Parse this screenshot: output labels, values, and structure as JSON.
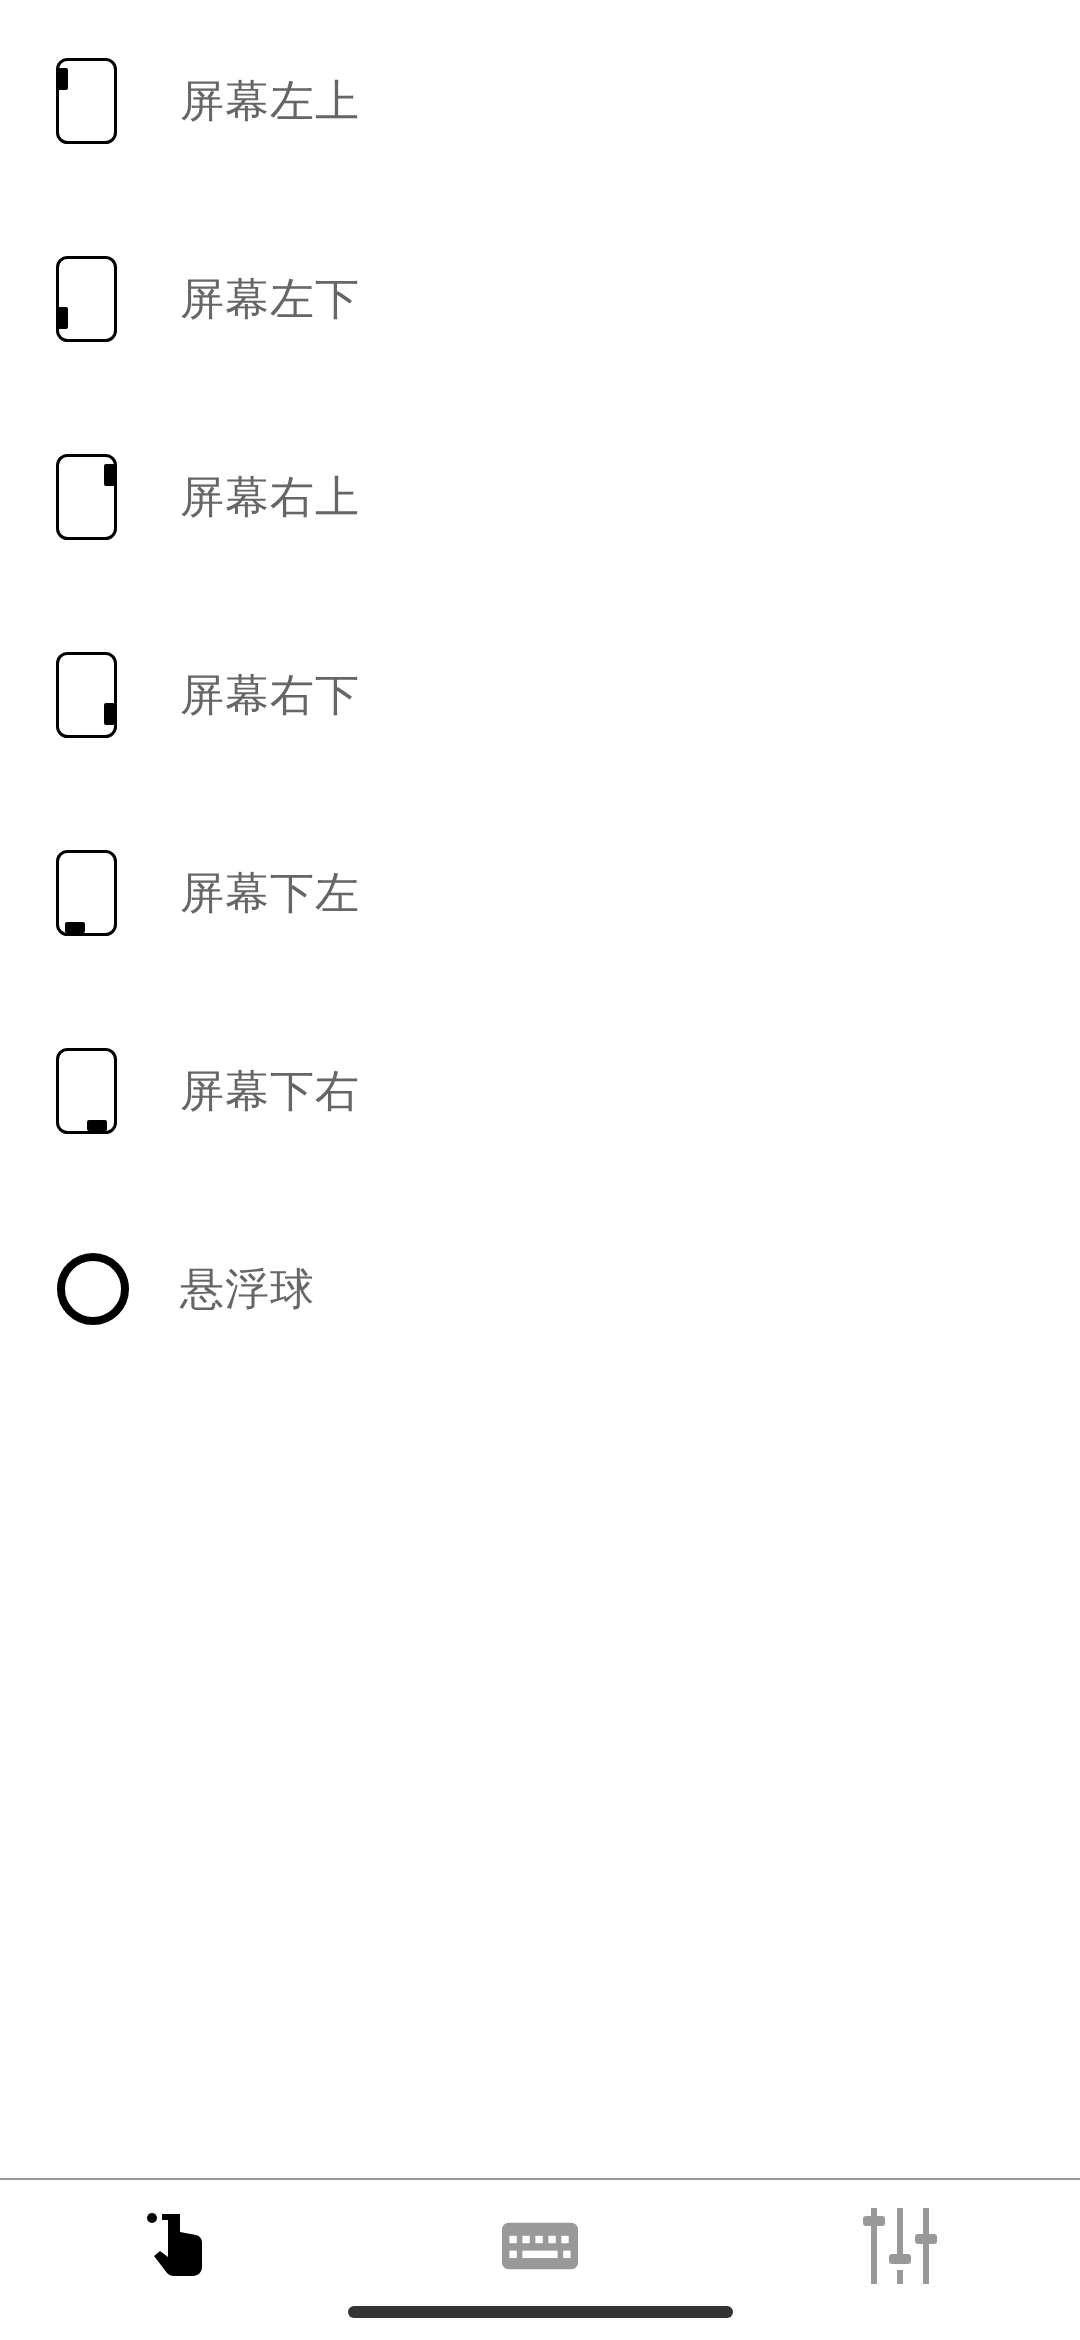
{
  "items": [
    {
      "kind": "lefttop",
      "label": "屏幕左上"
    },
    {
      "kind": "leftbottom",
      "label": "屏幕左下"
    },
    {
      "kind": "righttop",
      "label": "屏幕右上"
    },
    {
      "kind": "rightbottom",
      "label": "屏幕右下"
    },
    {
      "kind": "bottomleft",
      "label": "屏幕下左"
    },
    {
      "kind": "bottomright",
      "label": "屏幕下右"
    },
    {
      "kind": "ball",
      "label": "悬浮球"
    }
  ],
  "tabs": [
    {
      "kind": "gesture",
      "selected": true
    },
    {
      "kind": "keyboard",
      "selected": false
    },
    {
      "kind": "settings",
      "selected": false
    }
  ]
}
